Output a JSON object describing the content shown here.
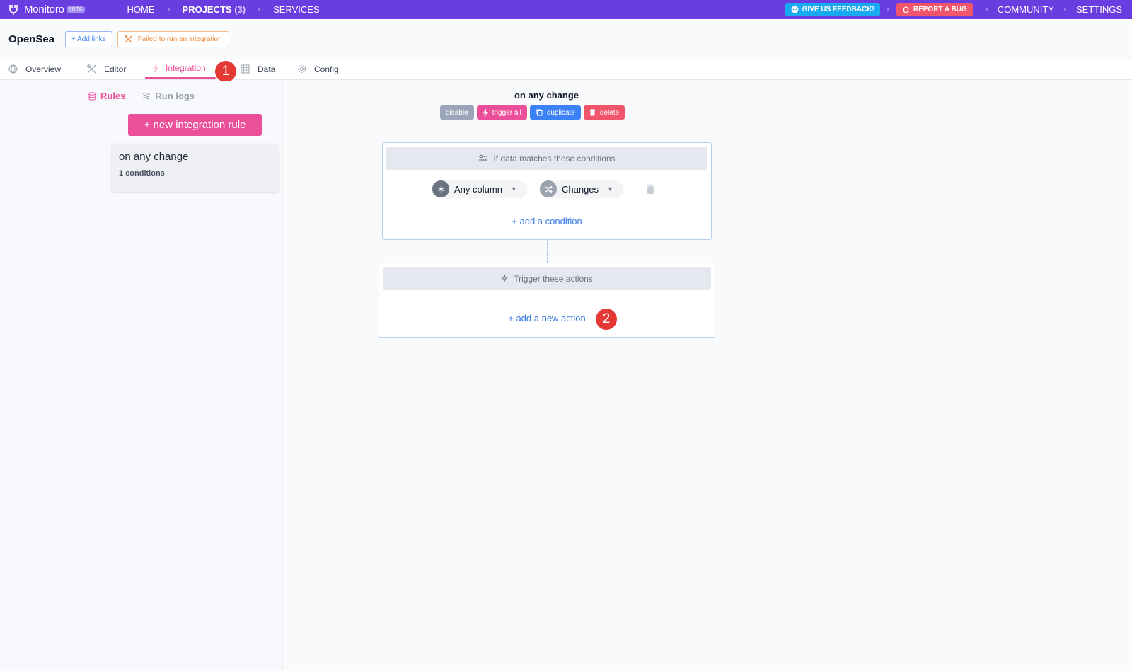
{
  "app": {
    "name": "Monitoro",
    "badge": "BETA"
  },
  "nav": {
    "home": "HOME",
    "projects": "PROJECTS",
    "projects_count": "(3)",
    "services": "SERVICES",
    "feedback": "GIVE US FEEDBACK!",
    "report_bug": "REPORT A BUG",
    "community": "COMMUNITY",
    "settings": "SETTINGS"
  },
  "project": {
    "name": "OpenSea",
    "add_links": "+ Add links",
    "failed": "Failed to run an integration"
  },
  "tabs": [
    {
      "label": "Overview",
      "icon": "globe-icon"
    },
    {
      "label": "Editor",
      "icon": "tools-icon"
    },
    {
      "label": "Integration",
      "icon": "bolt-icon",
      "active": true
    },
    {
      "label": "Data",
      "icon": "table-icon"
    },
    {
      "label": "Config",
      "icon": "gear-icon"
    }
  ],
  "markers": {
    "one": "1",
    "two": "2"
  },
  "sidebar": {
    "rules": "Rules",
    "run_logs": "Run logs",
    "new_rule": "+ new integration rule",
    "rule_title": "on any change",
    "rule_sub": "1 conditions"
  },
  "rule": {
    "title": "on any change",
    "disable": "disable",
    "trigger_all": "trigger all",
    "duplicate": "duplicate",
    "delete": "delete"
  },
  "conditions": {
    "header": "If data matches these conditions",
    "column": "Any column",
    "operator": "Changes",
    "add": "+ add a condition"
  },
  "actions": {
    "header": "Trigger these actions",
    "add": "+ add a new action"
  },
  "colors": {
    "topbar": "#6a3de0",
    "accent_pink": "#ec4f9a",
    "link_blue": "#3b7be8",
    "marker_red": "#e53935"
  }
}
